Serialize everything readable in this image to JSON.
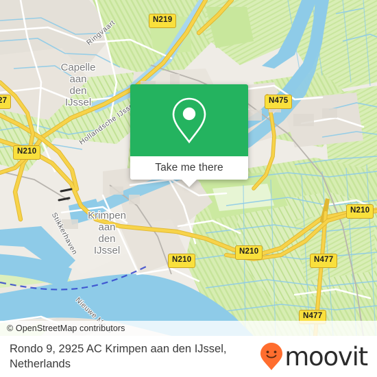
{
  "map": {
    "attribution": "© OpenStreetMap contributors",
    "place_labels": [
      {
        "name": "capelle-aan-den-ijssel",
        "text": "Capelle\naan\nden\nIJssel"
      },
      {
        "name": "krimpen-aan-den-ijssel",
        "text": "Krimpen\naan\nden\nIJssel"
      }
    ],
    "water_labels": [
      {
        "name": "ringvaart",
        "text": "Ringvaart"
      },
      {
        "name": "hollandsche-ijssel",
        "text": "Hollandsche IJssel"
      },
      {
        "name": "stikkerhaven",
        "text": "Stikkerhaven"
      },
      {
        "name": "nieuwe-maas",
        "text": "Nieuwe Maas"
      }
    ],
    "road_shields": [
      {
        "name": "shield-n219",
        "text": "N219"
      },
      {
        "name": "shield-n475",
        "text": "N475"
      },
      {
        "name": "shield-a27",
        "text": "27"
      },
      {
        "name": "shield-n210-west",
        "text": "N210"
      },
      {
        "name": "shield-n210-east",
        "text": "N210"
      },
      {
        "name": "shield-n210-center",
        "text": "N210"
      },
      {
        "name": "shield-n210-south",
        "text": "N210"
      },
      {
        "name": "shield-n477-upper",
        "text": "N477"
      },
      {
        "name": "shield-n477-lower",
        "text": "N477"
      }
    ],
    "colors": {
      "land": "#efedе8",
      "farmland": "#d4ecac",
      "green": "#c4e6a0",
      "water": "#8ecbe8",
      "road_yellow": "#f7d34a",
      "road_white": "#ffffff",
      "built": "#e8e3dd"
    }
  },
  "popup": {
    "cta_label": "Take me there",
    "pin_icon": "location-pin-icon",
    "header_color": "#24b35f"
  },
  "footer": {
    "address": "Rondo 9, 2925 AC Krimpen aan den IJssel, Netherlands",
    "brand": "moovit",
    "brand_pin_color": "#ff6d2e"
  }
}
